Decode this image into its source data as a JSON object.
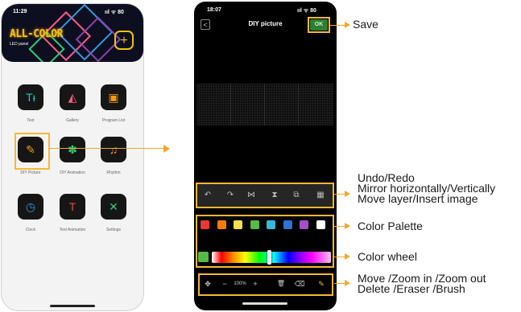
{
  "left_phone": {
    "status_time": "11:29",
    "status_icons": "ııl ᯤ 80",
    "brand": "ALL-COLOR",
    "brand_sub": "LED panel",
    "add_symbol": "+",
    "apps": [
      {
        "label": "Text",
        "icon": "text-icon",
        "glyph": "Tᵼ",
        "color": "#28c7c7"
      },
      {
        "label": "Gallery",
        "icon": "gallery-icon",
        "glyph": "◭",
        "color": "#ff5a8a"
      },
      {
        "label": "Program List",
        "icon": "program-list-icon",
        "glyph": "▣",
        "color": "#f39c12"
      },
      {
        "label": "DIY Picture",
        "icon": "diy-picture-icon",
        "glyph": "✎",
        "color": "#f39c12"
      },
      {
        "label": "DIY Animation",
        "icon": "diy-animation-icon",
        "glyph": "✽",
        "color": "#2ecc71"
      },
      {
        "label": "Rhythm",
        "icon": "rhythm-icon",
        "glyph": "♫",
        "color": "#f39c12"
      },
      {
        "label": "Clock",
        "icon": "clock-icon",
        "glyph": "◷",
        "color": "#3498db"
      },
      {
        "label": "Text Animation",
        "icon": "text-animation-icon",
        "glyph": "T",
        "color": "#e74c3c"
      },
      {
        "label": "Settings",
        "icon": "settings-icon",
        "glyph": "✕",
        "color": "#2ecc71"
      }
    ]
  },
  "right_phone": {
    "status_time": "18:07",
    "status_icons": "ııl ᯤ 80",
    "title": "DIY picture",
    "back_symbol": "<",
    "ok_label": "OK",
    "toolbar": [
      {
        "icon": "undo-icon",
        "glyph": "↶"
      },
      {
        "icon": "redo-icon",
        "glyph": "↷"
      },
      {
        "icon": "mirror-horizontal-icon",
        "glyph": "⋈"
      },
      {
        "icon": "mirror-vertical-icon",
        "glyph": "⧗"
      },
      {
        "icon": "move-layer-icon",
        "glyph": "⧉"
      },
      {
        "icon": "insert-image-icon",
        "glyph": "▦"
      }
    ],
    "palette": [
      "#e53935",
      "#f57c00",
      "#f4e04d",
      "#57b947",
      "#36b8d6",
      "#2f6fd6",
      "#a64fc9",
      "#ffffff"
    ],
    "current_color": "#57b947",
    "hue_level": 0.48,
    "bottom_tools": {
      "move_glyph": "✥",
      "zoom_out_glyph": "−",
      "zoom_level": "100%",
      "zoom_in_glyph": "+",
      "delete_glyph": "🗑",
      "eraser_glyph": "⌫",
      "brush_glyph": "✎"
    }
  },
  "annotations": {
    "save": "Save",
    "toolbar_line1": "Undo/Redo",
    "toolbar_line2": "Mirror horizontally/Vertically",
    "toolbar_line3": "Move layer/Insert image",
    "palette": "Color Palette",
    "wheel": "Color wheel",
    "bottom_line1": "Move /Zoom in /Zoom out",
    "bottom_line2": "Delete /Eraser /Brush"
  },
  "colors": {
    "accent": "#f7a823",
    "highlight_box": "#f7b733"
  }
}
